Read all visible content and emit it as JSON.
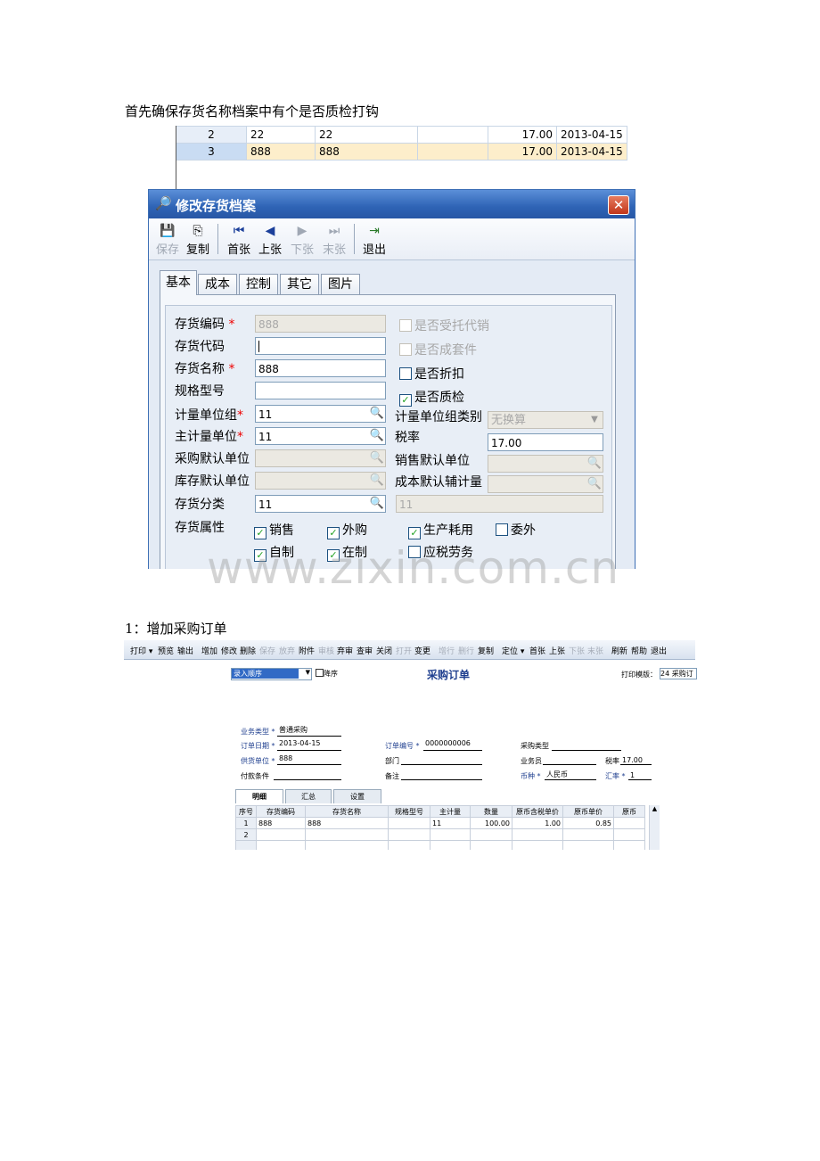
{
  "doc": {
    "intro": "首先确保存货名称档案中有个是否质检打钩",
    "step1": "1：增加采购订单",
    "watermark": "www.zixin.com.cn"
  },
  "bg_grid": {
    "rows": [
      [
        "2",
        "22",
        "22",
        "",
        "17.00",
        "2013-04-15"
      ],
      [
        "3",
        "888",
        "888",
        "",
        "17.00",
        "2013-04-15"
      ]
    ]
  },
  "dialog": {
    "title": "修改存货档案",
    "toolbar": [
      {
        "label": "保存",
        "icon": "save-icon",
        "enabled": false
      },
      {
        "label": "复制",
        "icon": "copy-icon",
        "enabled": true
      },
      {
        "label": "首张",
        "icon": "first-icon",
        "enabled": true
      },
      {
        "label": "上张",
        "icon": "prev-icon",
        "enabled": true
      },
      {
        "label": "下张",
        "icon": "next-icon",
        "enabled": false
      },
      {
        "label": "末张",
        "icon": "last-icon",
        "enabled": false
      },
      {
        "label": "退出",
        "icon": "exit-icon",
        "enabled": true
      }
    ],
    "tabs": [
      "基本",
      "成本",
      "控制",
      "其它",
      "图片"
    ],
    "fields": {
      "code_label": "存货编码",
      "code_value": "888",
      "alias_label": "存货代码",
      "alias_value": "",
      "name_label": "存货名称",
      "name_value": "888",
      "spec_label": "规格型号",
      "spec_value": "",
      "unitgroup_label": "计量单位组",
      "unitgroup_value": "11",
      "mainunit_label": "主计量单位",
      "mainunit_value": "11",
      "purunit_label": "采购默认单位",
      "purunit_value": "",
      "stockunit_label": "库存默认单位",
      "stockunit_value": "",
      "category_label": "存货分类",
      "category_value": "11",
      "category_name": "11",
      "unitgrouptype_label": "计量单位组类别",
      "unitgrouptype_value": "无换算",
      "tax_label": "税率",
      "tax_value": "17.00",
      "saleunit_label": "销售默认单位",
      "saleunit_value": "",
      "costunit_label": "成本默认辅计量",
      "costunit_value": "",
      "attr_label": "存货属性",
      "required_mark": "*"
    },
    "checks": {
      "consign": {
        "label": "是否受托代销",
        "checked": false
      },
      "kit": {
        "label": "是否成套件",
        "checked": false
      },
      "discount": {
        "label": "是否折扣",
        "checked": false
      },
      "qc": {
        "label": "是否质检",
        "checked": true
      }
    },
    "attrs": [
      {
        "label": "销售",
        "checked": true
      },
      {
        "label": "外购",
        "checked": true
      },
      {
        "label": "生产耗用",
        "checked": true
      },
      {
        "label": "委外",
        "checked": false
      },
      {
        "label": "自制",
        "checked": true
      },
      {
        "label": "在制",
        "checked": true
      },
      {
        "label": "应税劳务",
        "checked": false
      }
    ]
  },
  "po": {
    "toolbar": [
      "打印 ▾",
      "预览",
      "输出",
      "增加",
      "修改",
      "删除",
      "保存",
      "放弃",
      "附件",
      "审核",
      "弃审",
      "查审",
      "关闭",
      "打开",
      "变更",
      "增行",
      "删行",
      "复制",
      "定位 ▾",
      "首张",
      "上张",
      "下张",
      "末张",
      "刷新",
      "帮助",
      "退出"
    ],
    "toolbar_disabled": [
      "保存",
      "放弃",
      "审核",
      "打开",
      "增行",
      "删行",
      "下张",
      "末张"
    ],
    "sort_select": "录入顺序",
    "desc_label": "降序",
    "title": "采购订单",
    "print_template_label": "打印模版：",
    "print_template_value": "24 采购订",
    "fields": [
      {
        "label": "业务类型",
        "value": "普通采购",
        "req": true
      },
      {
        "label": "订单日期",
        "value": "2013-04-15",
        "req": true
      },
      {
        "label": "订单编号",
        "value": "0000000006",
        "req": true
      },
      {
        "label": "采购类型",
        "value": "",
        "req": false
      },
      {
        "label": "供货单位",
        "value": "888",
        "req": true
      },
      {
        "label": "部门",
        "value": "",
        "req": false
      },
      {
        "label": "业务员",
        "value": "",
        "req": false
      },
      {
        "label": "税率",
        "value": "17.00",
        "req": false
      },
      {
        "label": "付款条件",
        "value": "",
        "req": false
      },
      {
        "label": "备注",
        "value": "",
        "req": false
      },
      {
        "label": "币种",
        "value": "人民币",
        "req": true
      },
      {
        "label": "汇率",
        "value": "1",
        "req": true
      }
    ],
    "tabs": [
      "明细",
      "汇总",
      "设置"
    ],
    "columns": [
      "序号",
      "存货编码",
      "存货名称",
      "规格型号",
      "主计量",
      "数量",
      "原币含税单价",
      "原币单价",
      "原币"
    ],
    "rows": [
      [
        "1",
        "888",
        "888",
        "",
        "11",
        "100.00",
        "1.00",
        "0.85",
        ""
      ],
      [
        "2",
        "",
        "",
        "",
        "",
        "",
        "",
        "",
        ""
      ]
    ]
  }
}
